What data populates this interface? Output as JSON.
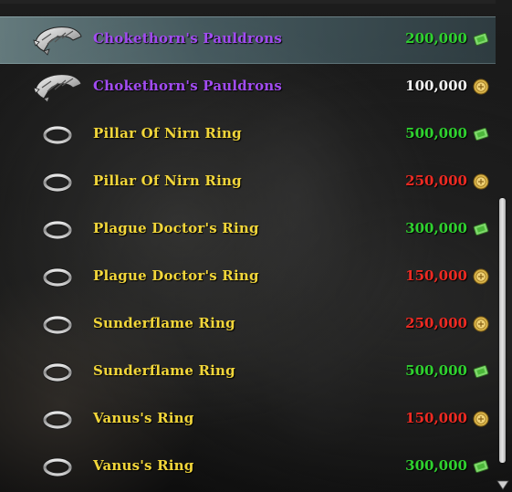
{
  "store": {
    "items": [
      {
        "name": "Chokethorn's Pauldrons",
        "name_color": "purple",
        "price": "200,000",
        "price_color": "green",
        "currency": "crown-gem-icon",
        "item_icon": "pauldron-icon",
        "selected": true
      },
      {
        "name": "Chokethorn's Pauldrons",
        "name_color": "purple",
        "price": "100,000",
        "price_color": "white",
        "currency": "gold-coin-icon",
        "item_icon": "pauldron-icon",
        "selected": false
      },
      {
        "name": "Pillar Of Nirn Ring",
        "name_color": "yellow",
        "price": "500,000",
        "price_color": "green",
        "currency": "crown-gem-icon",
        "item_icon": "ring-icon",
        "selected": false
      },
      {
        "name": "Pillar Of Nirn Ring",
        "name_color": "yellow",
        "price": "250,000",
        "price_color": "red",
        "currency": "gold-coin-icon",
        "item_icon": "ring-icon",
        "selected": false
      },
      {
        "name": "Plague Doctor's Ring",
        "name_color": "yellow",
        "price": "300,000",
        "price_color": "green",
        "currency": "crown-gem-icon",
        "item_icon": "ring-icon",
        "selected": false
      },
      {
        "name": "Plague Doctor's Ring",
        "name_color": "yellow",
        "price": "150,000",
        "price_color": "red",
        "currency": "gold-coin-icon",
        "item_icon": "ring-icon",
        "selected": false
      },
      {
        "name": "Sunderflame Ring",
        "name_color": "yellow",
        "price": "250,000",
        "price_color": "red",
        "currency": "gold-coin-icon",
        "item_icon": "ring-icon",
        "selected": false
      },
      {
        "name": "Sunderflame Ring",
        "name_color": "yellow",
        "price": "500,000",
        "price_color": "green",
        "currency": "crown-gem-icon",
        "item_icon": "ring-icon",
        "selected": false
      },
      {
        "name": "Vanus's Ring",
        "name_color": "yellow",
        "price": "150,000",
        "price_color": "red",
        "currency": "gold-coin-icon",
        "item_icon": "ring-icon",
        "selected": false
      },
      {
        "name": "Vanus's Ring",
        "name_color": "yellow",
        "price": "300,000",
        "price_color": "green",
        "currency": "crown-gem-icon",
        "item_icon": "ring-icon",
        "selected": false
      }
    ]
  },
  "colors": {
    "purple": "#a24cf2",
    "yellow": "#f2d63a",
    "green": "#2fd22f",
    "red": "#ee2a22",
    "white": "#f2f2f2",
    "selection": "#7fa9b3"
  },
  "scrollbar": {
    "position_fraction": 0.42,
    "visible_fraction": 0.56
  }
}
